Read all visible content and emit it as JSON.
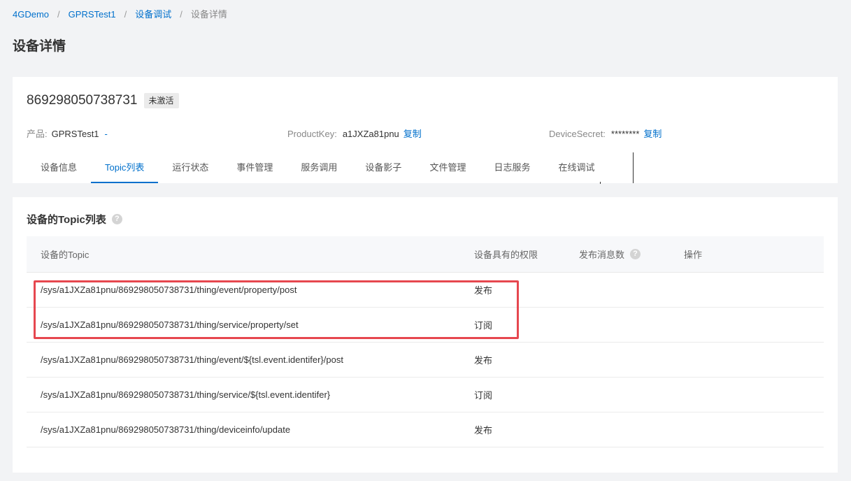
{
  "breadcrumb": {
    "items": [
      "4GDemo",
      "GPRSTest1",
      "设备调试"
    ],
    "current": "设备详情",
    "separator": "/"
  },
  "page_title": "设备详情",
  "device": {
    "name": "869298050738731",
    "status": "未激活",
    "product_label": "产品:",
    "product_value": "GPRSTest1",
    "product_link": "-",
    "productkey_label": "ProductKey:",
    "productkey_value": "a1JXZa81pnu",
    "productkey_copy": "复制",
    "secret_label": "DeviceSecret:",
    "secret_value": "********",
    "secret_copy": "复制"
  },
  "tabs": [
    {
      "label": "设备信息",
      "active": false
    },
    {
      "label": "Topic列表",
      "active": true
    },
    {
      "label": "运行状态",
      "active": false
    },
    {
      "label": "事件管理",
      "active": false
    },
    {
      "label": "服务调用",
      "active": false
    },
    {
      "label": "设备影子",
      "active": false
    },
    {
      "label": "文件管理",
      "active": false
    },
    {
      "label": "日志服务",
      "active": false
    },
    {
      "label": "在线调试",
      "active": false
    }
  ],
  "topic_section": {
    "title": "设备的Topic列表",
    "help_icon": "question-circle-icon",
    "columns": [
      "设备的Topic",
      "设备具有的权限",
      "发布消息数",
      "操作"
    ],
    "rows": [
      {
        "topic": "/sys/a1JXZa81pnu/869298050738731/thing/event/property/post",
        "permission": "发布",
        "count": "",
        "action": ""
      },
      {
        "topic": "/sys/a1JXZa81pnu/869298050738731/thing/service/property/set",
        "permission": "订阅",
        "count": "",
        "action": ""
      },
      {
        "topic": "/sys/a1JXZa81pnu/869298050738731/thing/event/${tsl.event.identifer}/post",
        "permission": "发布",
        "count": "",
        "action": ""
      },
      {
        "topic": "/sys/a1JXZa81pnu/869298050738731/thing/service/${tsl.event.identifer}",
        "permission": "订阅",
        "count": "",
        "action": ""
      },
      {
        "topic": "/sys/a1JXZa81pnu/869298050738731/thing/deviceinfo/update",
        "permission": "发布",
        "count": "",
        "action": ""
      }
    ]
  },
  "colors": {
    "link": "#0070cc",
    "highlight": "#e6474f"
  }
}
